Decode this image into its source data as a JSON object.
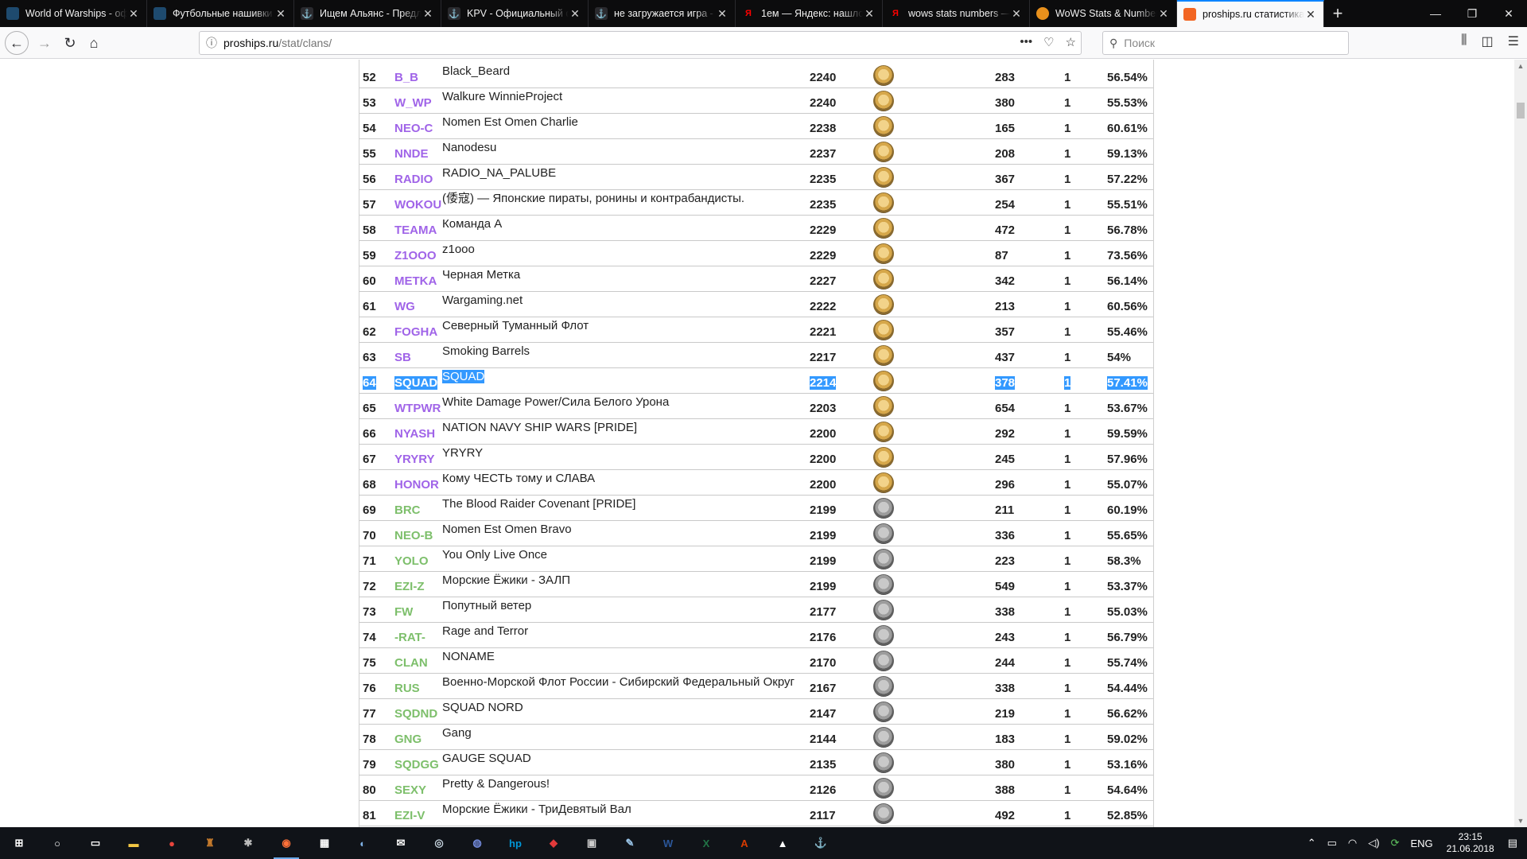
{
  "tabs": [
    {
      "title": "World of Warships - офи",
      "favicon": "ws",
      "fav_color": "#1e4a6e",
      "active": false
    },
    {
      "title": "Футбольные нашивки в",
      "favicon": "ws",
      "fav_color": "#1e4a6e",
      "active": false
    },
    {
      "title": "Ищем Альянс - Предл",
      "favicon": "anchor",
      "fav_color": "#2a2a2e",
      "active": false
    },
    {
      "title": "KPV - Официальный ф",
      "favicon": "anchor",
      "fav_color": "#2a2a2e",
      "active": false
    },
    {
      "title": "не загружается игра - Т",
      "favicon": "anchor",
      "fav_color": "#2a2a2e",
      "active": false
    },
    {
      "title": "1ем — Яндекс: нашлос",
      "favicon": "Я",
      "fav_color": "#ff0000",
      "active": false
    },
    {
      "title": "wows stats numbers — ",
      "favicon": "Я",
      "fav_color": "#ff0000",
      "active": false
    },
    {
      "title": "WoWS Stats & Numbers",
      "favicon": "circle",
      "fav_color": "#e8901c",
      "active": false
    },
    {
      "title": "proships.ru статистика,",
      "favicon": "square",
      "fav_color": "#f26522",
      "active": true
    }
  ],
  "nav": {
    "back_label": "←",
    "forward_label": "→",
    "reload_label": "↻",
    "home_label": "⌂",
    "url_host": "proships.ru",
    "url_path": "/stat/clans/",
    "search_placeholder": "Поиск"
  },
  "table": {
    "rows": [
      {
        "rank": "52",
        "tag": "B_B",
        "name": "Black_Beard",
        "rating": "2240",
        "league": "gold",
        "count": "1",
        "battles": "283",
        "winrate": "56.54%"
      },
      {
        "rank": "53",
        "tag": "W_WP",
        "name": "Walkure WinnieProject",
        "rating": "2240",
        "league": "gold",
        "count": "1",
        "battles": "380",
        "winrate": "55.53%"
      },
      {
        "rank": "54",
        "tag": "NEO-C",
        "name": "Nomen Est Omen Charlie",
        "rating": "2238",
        "league": "gold",
        "count": "1",
        "battles": "165",
        "winrate": "60.61%"
      },
      {
        "rank": "55",
        "tag": "NNDE",
        "name": "Nanodesu",
        "rating": "2237",
        "league": "gold",
        "count": "1",
        "battles": "208",
        "winrate": "59.13%"
      },
      {
        "rank": "56",
        "tag": "RADIO",
        "name": "RADIO_NA_PALUBE",
        "rating": "2235",
        "league": "gold",
        "count": "1",
        "battles": "367",
        "winrate": "57.22%"
      },
      {
        "rank": "57",
        "tag": "WOKOU",
        "name": "(倭寇) — Японские пираты, ронины и контрабандисты.",
        "rating": "2235",
        "league": "gold",
        "count": "1",
        "battles": "254",
        "winrate": "55.51%"
      },
      {
        "rank": "58",
        "tag": "TEAMA",
        "name": "Команда А",
        "rating": "2229",
        "league": "gold",
        "count": "1",
        "battles": "472",
        "winrate": "56.78%"
      },
      {
        "rank": "59",
        "tag": "Z1OOO",
        "name": "z1ooo",
        "rating": "2229",
        "league": "gold",
        "count": "1",
        "battles": "87",
        "winrate": "73.56%"
      },
      {
        "rank": "60",
        "tag": "METKA",
        "name": "Черная Метка",
        "rating": "2227",
        "league": "gold",
        "count": "1",
        "battles": "342",
        "winrate": "56.14%"
      },
      {
        "rank": "61",
        "tag": "WG",
        "name": "Wargaming.net",
        "rating": "2222",
        "league": "gold",
        "count": "1",
        "battles": "213",
        "winrate": "60.56%"
      },
      {
        "rank": "62",
        "tag": "FOGHA",
        "name": "Северный Туманный Флот",
        "rating": "2221",
        "league": "gold",
        "count": "1",
        "battles": "357",
        "winrate": "55.46%"
      },
      {
        "rank": "63",
        "tag": "SB",
        "name": "Smoking Barrels",
        "rating": "2217",
        "league": "gold",
        "count": "1",
        "battles": "437",
        "winrate": "54%"
      },
      {
        "rank": "64",
        "tag": "SQUAD",
        "name": "SQUAD",
        "rating": "2214",
        "league": "gold",
        "count": "1",
        "battles": "378",
        "winrate": "57.41%",
        "selected": true
      },
      {
        "rank": "65",
        "tag": "WTPWR",
        "name": "White Damage Power/Сила Белого Урона",
        "rating": "2203",
        "league": "gold",
        "count": "1",
        "battles": "654",
        "winrate": "53.67%"
      },
      {
        "rank": "66",
        "tag": "NYASH",
        "name": "NATION NAVY SHIP WARS [PRIDE]",
        "rating": "2200",
        "league": "gold",
        "count": "1",
        "battles": "292",
        "winrate": "59.59%"
      },
      {
        "rank": "67",
        "tag": "YRYRY",
        "name": "YRYRY",
        "rating": "2200",
        "league": "gold",
        "count": "1",
        "battles": "245",
        "winrate": "57.96%"
      },
      {
        "rank": "68",
        "tag": "HONOR",
        "name": "Кому ЧЕСТЬ тому и СЛАВА",
        "rating": "2200",
        "league": "gold",
        "count": "1",
        "battles": "296",
        "winrate": "55.07%"
      },
      {
        "rank": "69",
        "tag": "BRC",
        "name": "The Blood Raider Covenant [PRIDE]",
        "rating": "2199",
        "league": "silver",
        "count": "1",
        "battles": "211",
        "winrate": "60.19%"
      },
      {
        "rank": "70",
        "tag": "NEO-B",
        "name": "Nomen Est Omen Bravo",
        "rating": "2199",
        "league": "silver",
        "count": "1",
        "battles": "336",
        "winrate": "55.65%"
      },
      {
        "rank": "71",
        "tag": "YOLO",
        "name": "You Only Live Once",
        "rating": "2199",
        "league": "silver",
        "count": "1",
        "battles": "223",
        "winrate": "58.3%"
      },
      {
        "rank": "72",
        "tag": "EZI-Z",
        "name": "Морские Ёжики - ЗАЛП",
        "rating": "2199",
        "league": "silver",
        "count": "1",
        "battles": "549",
        "winrate": "53.37%"
      },
      {
        "rank": "73",
        "tag": "FW",
        "name": "Попутный ветер",
        "rating": "2177",
        "league": "silver",
        "count": "1",
        "battles": "338",
        "winrate": "55.03%"
      },
      {
        "rank": "74",
        "tag": "-RAT-",
        "name": "Rage and Terror",
        "rating": "2176",
        "league": "silver",
        "count": "1",
        "battles": "243",
        "winrate": "56.79%"
      },
      {
        "rank": "75",
        "tag": "CLAN",
        "name": "NONAME",
        "rating": "2170",
        "league": "silver",
        "count": "1",
        "battles": "244",
        "winrate": "55.74%"
      },
      {
        "rank": "76",
        "tag": "RUS",
        "name": "Военно-Морской Флот России - Сибирский Федеральный Округ",
        "rating": "2167",
        "league": "silver",
        "count": "1",
        "battles": "338",
        "winrate": "54.44%"
      },
      {
        "rank": "77",
        "tag": "SQDND",
        "name": "SQUAD NORD",
        "rating": "2147",
        "league": "silver",
        "count": "1",
        "battles": "219",
        "winrate": "56.62%"
      },
      {
        "rank": "78",
        "tag": "GNG",
        "name": "Gang",
        "rating": "2144",
        "league": "silver",
        "count": "1",
        "battles": "183",
        "winrate": "59.02%"
      },
      {
        "rank": "79",
        "tag": "SQDGG",
        "name": "GAUGE SQUAD",
        "rating": "2135",
        "league": "silver",
        "count": "1",
        "battles": "380",
        "winrate": "53.16%"
      },
      {
        "rank": "80",
        "tag": "SEXY",
        "name": "Pretty & Dangerous!",
        "rating": "2126",
        "league": "silver",
        "count": "1",
        "battles": "388",
        "winrate": "54.64%"
      },
      {
        "rank": "81",
        "tag": "EZI-V",
        "name": "Морские Ёжики - ТриДевятый Вал",
        "rating": "2117",
        "league": "silver",
        "count": "1",
        "battles": "492",
        "winrate": "52.85%"
      }
    ]
  },
  "colors": {
    "tag_gold_league": "#a064e8",
    "tag_silver_league": "#7dbf6b",
    "selection": "#3399ff",
    "active_tab_accent": "#0a84ff"
  },
  "taskbar": {
    "apps": [
      {
        "name": "start-icon",
        "glyph": "⊞",
        "color": "#ffffff",
        "running": false
      },
      {
        "name": "search-icon",
        "glyph": "○",
        "color": "#ffffff",
        "running": false
      },
      {
        "name": "task-view-icon",
        "glyph": "▭",
        "color": "#ffffff",
        "running": false
      },
      {
        "name": "file-explorer-icon",
        "glyph": "▬",
        "color": "#f2c744",
        "running": false
      },
      {
        "name": "chrome-icon",
        "glyph": "●",
        "color": "#e8453c",
        "running": false
      },
      {
        "name": "game-icon",
        "glyph": "♜",
        "color": "#c47a2c",
        "running": false
      },
      {
        "name": "spider-app-icon",
        "glyph": "✱",
        "color": "#bbbbbb",
        "running": false
      },
      {
        "name": "firefox-icon",
        "glyph": "◉",
        "color": "#ff7139",
        "running": true
      },
      {
        "name": "calculator-icon",
        "glyph": "▦",
        "color": "#ffffff",
        "running": false
      },
      {
        "name": "media-app-icon",
        "glyph": "◐",
        "color": "#7fb2e6",
        "running": false
      },
      {
        "name": "mail-icon",
        "glyph": "✉",
        "color": "#ffffff",
        "running": false
      },
      {
        "name": "steam-icon",
        "glyph": "◎",
        "color": "#c7d5e0",
        "running": false
      },
      {
        "name": "discord-icon",
        "glyph": "◍",
        "color": "#7289da",
        "running": false
      },
      {
        "name": "hp-icon",
        "glyph": "hp",
        "color": "#0096d6",
        "running": false
      },
      {
        "name": "overlay-app-icon",
        "glyph": "◆",
        "color": "#e23a3a",
        "running": false
      },
      {
        "name": "photos-icon",
        "glyph": "▣",
        "color": "#cccccc",
        "running": false
      },
      {
        "name": "paint-icon",
        "glyph": "✎",
        "color": "#9ac5e8",
        "running": false
      },
      {
        "name": "word-icon",
        "glyph": "W",
        "color": "#2b579a",
        "running": false
      },
      {
        "name": "excel-icon",
        "glyph": "X",
        "color": "#217346",
        "running": false
      },
      {
        "name": "pdf-icon",
        "glyph": "A",
        "color": "#d83b01",
        "running": false
      },
      {
        "name": "image-viewer-icon",
        "glyph": "▲",
        "color": "#ffffff",
        "running": false
      },
      {
        "name": "warships-launcher-icon",
        "glyph": "⚓",
        "color": "#b8c4cc",
        "running": false
      }
    ],
    "language": "ENG",
    "time": "23:15",
    "date": "21.06.2018"
  }
}
